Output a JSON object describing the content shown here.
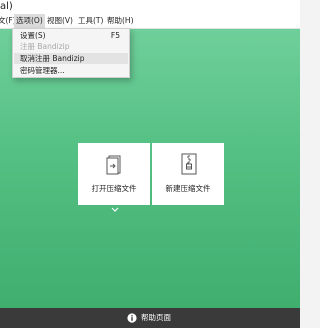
{
  "window": {
    "title_fragment": "al)"
  },
  "menubar": {
    "items": [
      {
        "label": "文(F)"
      },
      {
        "label": "选项(O)"
      },
      {
        "label": "视图(V)"
      },
      {
        "label": "工具(T)"
      },
      {
        "label": "帮助(H)"
      }
    ],
    "active_index": 1
  },
  "options_menu": {
    "items": [
      {
        "label": "设置(S)",
        "shortcut": "F5",
        "enabled": true
      },
      {
        "label": "注册 Bandizip",
        "shortcut": "",
        "enabled": false
      },
      {
        "label": "取消注册 Bandizip",
        "shortcut": "",
        "enabled": true,
        "highlighted": true
      },
      {
        "label": "密码管理器...",
        "shortcut": "",
        "enabled": true
      }
    ]
  },
  "main": {
    "open_archive_label": "打开压缩文件",
    "new_archive_label": "新建压缩文件",
    "background_color": "#54c083"
  },
  "footer": {
    "help_label": "帮助页面",
    "background_color": "#3a3a3a"
  },
  "icons": {
    "open": "open-archive-icon",
    "new": "new-archive-icon",
    "expand": "chevron-down-icon",
    "help": "info-icon"
  }
}
